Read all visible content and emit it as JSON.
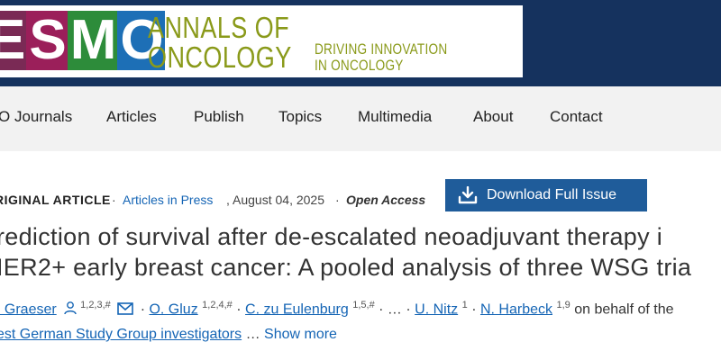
{
  "brand": {
    "logo_text": "ESMO",
    "journal_line1": "ANNALS OF",
    "journal_line2": "ONCOLOGY",
    "tagline_line1": "DRIVING INNOVATION",
    "tagline_line2": "IN ONCOLOGY",
    "colors": {
      "header_bg": "#15325e",
      "journal_green": "#8a9a1a"
    }
  },
  "nav": {
    "items": [
      {
        "label": "O Journals"
      },
      {
        "label": "Articles"
      },
      {
        "label": "Publish"
      },
      {
        "label": "Topics"
      },
      {
        "label": "Multimedia"
      },
      {
        "label": "About"
      },
      {
        "label": "Contact"
      }
    ]
  },
  "article": {
    "type": "RIGINAL ARTICLE",
    "section": "Articles in Press",
    "date": "August 04, 2025",
    "access": "Open Access",
    "download_label": "Download Full Issue",
    "title_line1": "rediction of survival after de-escalated neoadjuvant therapy i",
    "title_line2": "IER2+ early breast cancer: A pooled analysis of three WSG tria",
    "authors": [
      {
        "name": ". Graeser",
        "sup": "1,2,3,#"
      },
      {
        "name": "O. Gluz",
        "sup": "1,2,4,#"
      },
      {
        "name": "C. zu Eulenburg",
        "sup": "1,5,#"
      },
      {
        "name": "U. Nitz",
        "sup": "1"
      },
      {
        "name": "N. Harbeck",
        "sup": "1,9"
      }
    ],
    "ellipsis": "…",
    "on_behalf": "on behalf of the",
    "group": "est German Study Group investigators",
    "more_ellipsis": "…",
    "show_more": "Show more"
  },
  "icons": {
    "person": "person-icon",
    "email": "envelope-icon",
    "download": "download-icon"
  }
}
